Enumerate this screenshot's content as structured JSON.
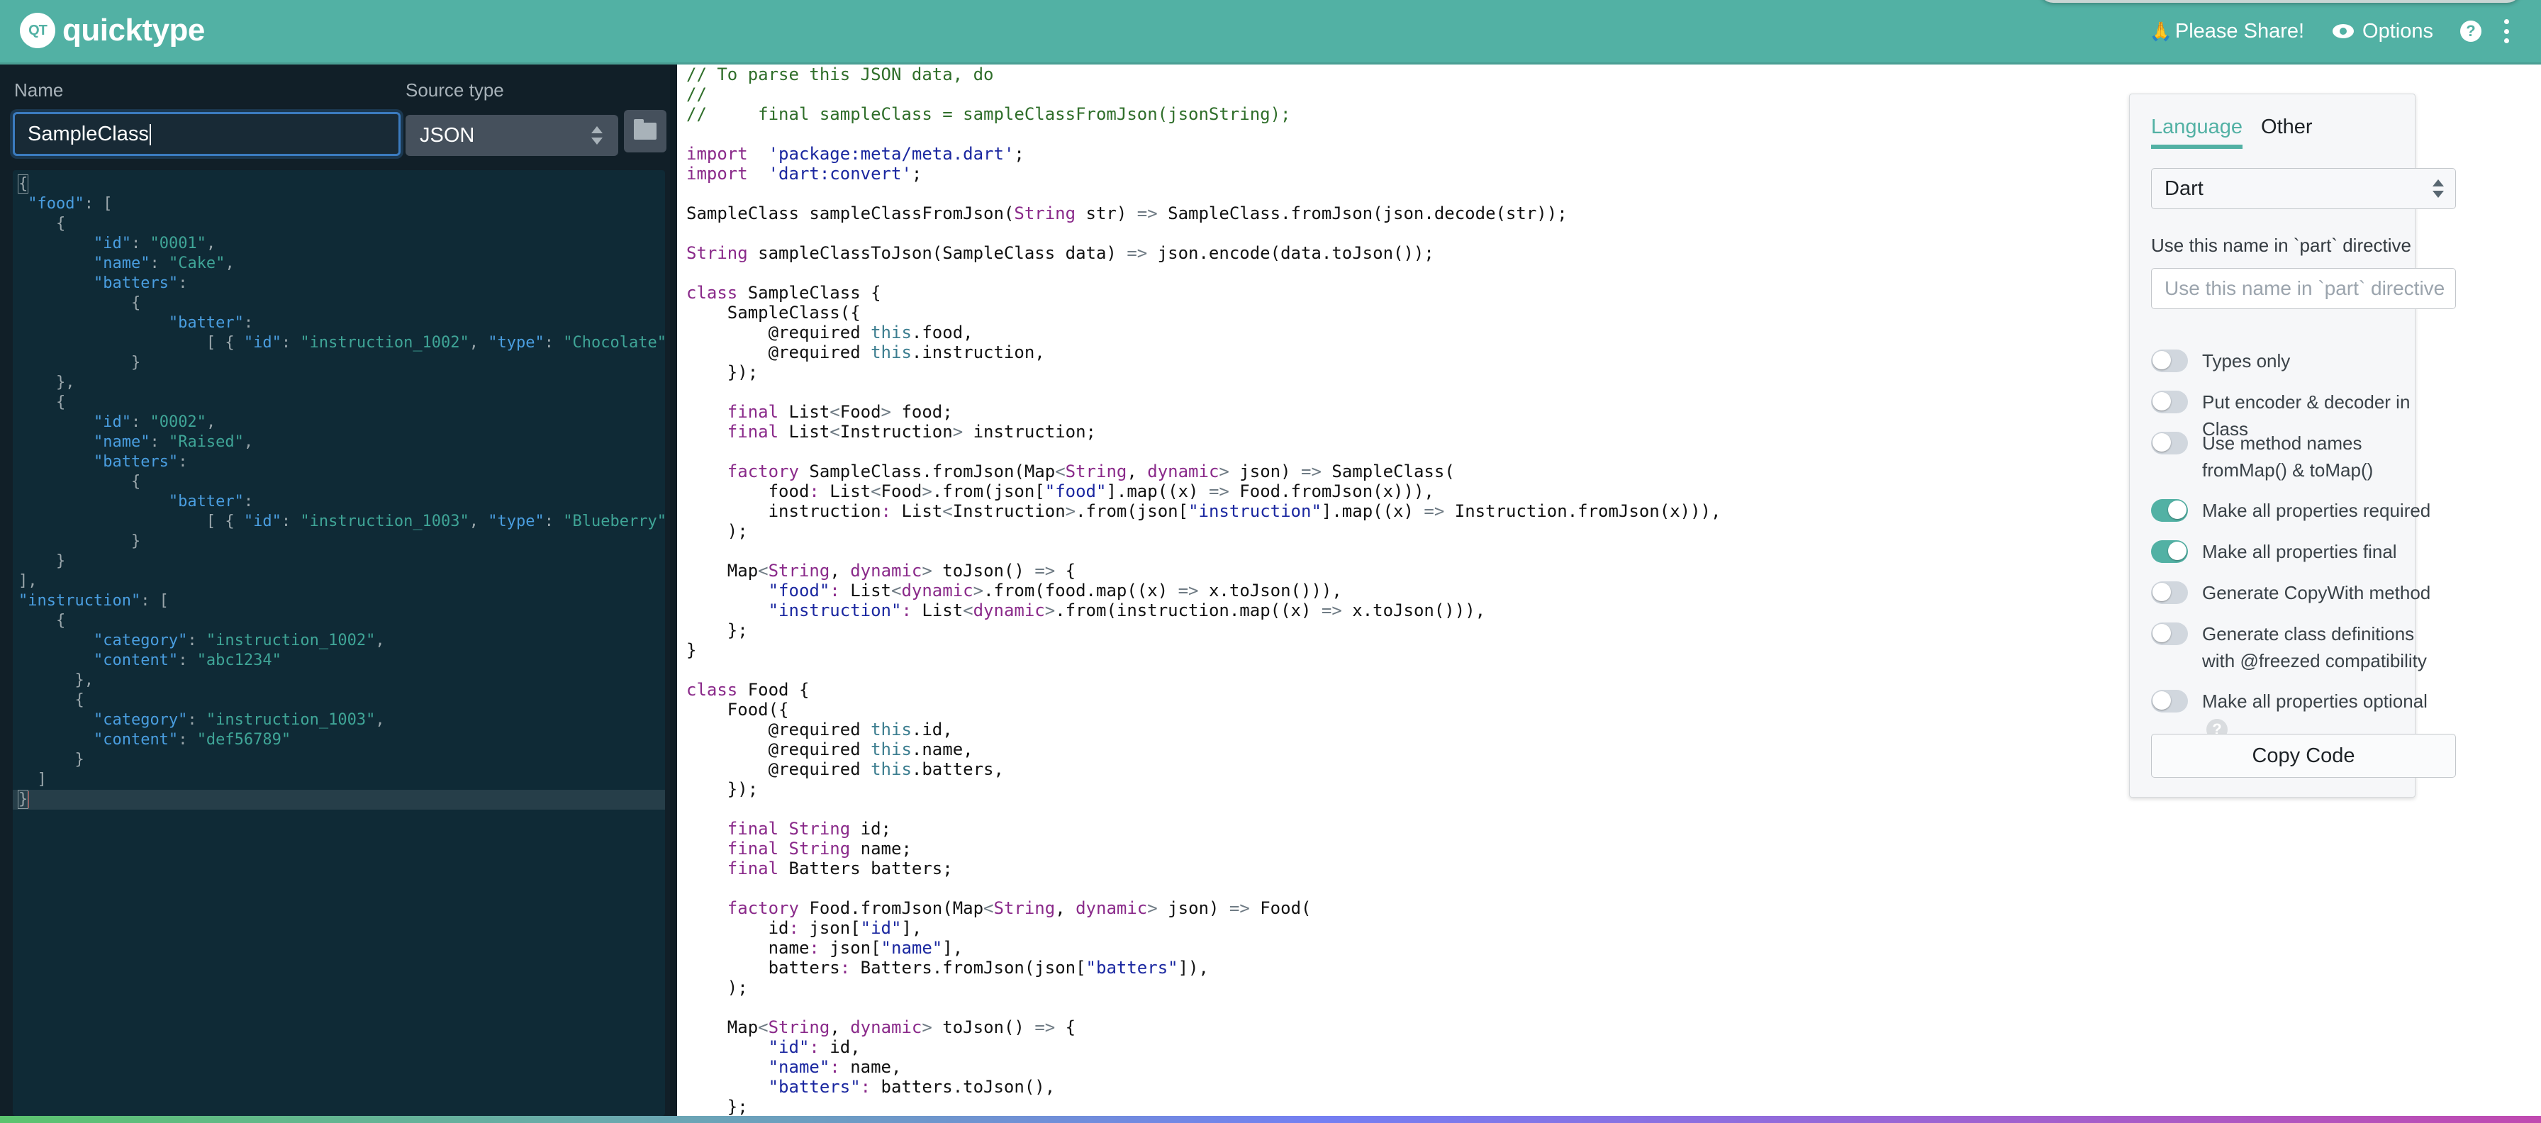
{
  "header": {
    "logo_badge": "QT",
    "logo_text": "quicktype",
    "share_emoji": "🙏",
    "share_label": "Please Share!",
    "options_label": "Options",
    "help_label": "?"
  },
  "source": {
    "name_label": "Name",
    "name_value": "SampleClass",
    "source_type_label": "Source type",
    "source_type_value": "JSON",
    "json_lines": [
      [
        [
          "jb",
          "{"
        ]
      ],
      [
        [
          "jb",
          " "
        ],
        [
          "jk",
          "\"food\""
        ],
        [
          "jb",
          ": ["
        ]
      ],
      [
        [
          "jb",
          "    {"
        ]
      ],
      [
        [
          "jb",
          "        "
        ],
        [
          "jk",
          "\"id\""
        ],
        [
          "jb",
          ": "
        ],
        [
          "js",
          "\"0001\""
        ],
        [
          "jb",
          ","
        ]
      ],
      [
        [
          "jb",
          "        "
        ],
        [
          "jk",
          "\"name\""
        ],
        [
          "jb",
          ": "
        ],
        [
          "js",
          "\"Cake\""
        ],
        [
          "jb",
          ","
        ]
      ],
      [
        [
          "jb",
          "        "
        ],
        [
          "jk",
          "\"batters\""
        ],
        [
          "jb",
          ":"
        ]
      ],
      [
        [
          "jb",
          "            {"
        ]
      ],
      [
        [
          "jb",
          "                "
        ],
        [
          "jk",
          "\"batter\""
        ],
        [
          "jb",
          ":"
        ]
      ],
      [
        [
          "jb",
          "                    [ { "
        ],
        [
          "jk",
          "\"id\""
        ],
        [
          "jb",
          ": "
        ],
        [
          "js",
          "\"instruction_1002\""
        ],
        [
          "jb",
          ", "
        ],
        [
          "jk",
          "\"type\""
        ],
        [
          "jb",
          ": "
        ],
        [
          "js",
          "\"Chocolate\""
        ],
        [
          "jb",
          " },"
        ]
      ],
      [
        [
          "jb",
          "            }"
        ]
      ],
      [
        [
          "jb",
          "    },"
        ]
      ],
      [
        [
          "jb",
          "    {"
        ]
      ],
      [
        [
          "jb",
          "        "
        ],
        [
          "jk",
          "\"id\""
        ],
        [
          "jb",
          ": "
        ],
        [
          "js",
          "\"0002\""
        ],
        [
          "jb",
          ","
        ]
      ],
      [
        [
          "jb",
          "        "
        ],
        [
          "jk",
          "\"name\""
        ],
        [
          "jb",
          ": "
        ],
        [
          "js",
          "\"Raised\""
        ],
        [
          "jb",
          ","
        ]
      ],
      [
        [
          "jb",
          "        "
        ],
        [
          "jk",
          "\"batters\""
        ],
        [
          "jb",
          ":"
        ]
      ],
      [
        [
          "jb",
          "            {"
        ]
      ],
      [
        [
          "jb",
          "                "
        ],
        [
          "jk",
          "\"batter\""
        ],
        [
          "jb",
          ":"
        ]
      ],
      [
        [
          "jb",
          "                    [ { "
        ],
        [
          "jk",
          "\"id\""
        ],
        [
          "jb",
          ": "
        ],
        [
          "js",
          "\"instruction_1003\""
        ],
        [
          "jb",
          ", "
        ],
        [
          "jk",
          "\"type\""
        ],
        [
          "jb",
          ": "
        ],
        [
          "js",
          "\"Blueberry\""
        ],
        [
          "jb",
          " },"
        ]
      ],
      [
        [
          "jb",
          "            }"
        ]
      ],
      [
        [
          "jb",
          "    }"
        ]
      ],
      [
        [
          "jb",
          "],"
        ]
      ],
      [
        [
          "jk",
          "\"instruction\""
        ],
        [
          "jb",
          ": ["
        ]
      ],
      [
        [
          "jb",
          "    {"
        ]
      ],
      [
        [
          "jb",
          "        "
        ],
        [
          "jk",
          "\"category\""
        ],
        [
          "jb",
          ": "
        ],
        [
          "js",
          "\"instruction_1002\""
        ],
        [
          "jb",
          ","
        ]
      ],
      [
        [
          "jb",
          "        "
        ],
        [
          "jk",
          "\"content\""
        ],
        [
          "jb",
          ": "
        ],
        [
          "js",
          "\"abc1234\""
        ]
      ],
      [
        [
          "jb",
          "      },"
        ]
      ],
      [
        [
          "jb",
          "      {"
        ]
      ],
      [
        [
          "jb",
          "        "
        ],
        [
          "jk",
          "\"category\""
        ],
        [
          "jb",
          ": "
        ],
        [
          "js",
          "\"instruction_1003\""
        ],
        [
          "jb",
          ","
        ]
      ],
      [
        [
          "jb",
          "        "
        ],
        [
          "jk",
          "\"content\""
        ],
        [
          "jb",
          ": "
        ],
        [
          "js",
          "\"def56789\""
        ]
      ],
      [
        [
          "jb",
          "      }"
        ]
      ],
      [
        [
          "jb",
          "  ]"
        ]
      ],
      [
        [
          "jb",
          "}"
        ]
      ]
    ]
  },
  "code_lines": [
    [
      [
        "c-com",
        "// To parse this JSON data, do"
      ]
    ],
    [
      [
        "c-com",
        "//"
      ]
    ],
    [
      [
        "c-com",
        "//     final sampleClass = sampleClassFromJson(jsonString);"
      ]
    ],
    [],
    [
      [
        "c-kw",
        "import"
      ],
      [
        "",
        "  "
      ],
      [
        "c-str",
        "'package:meta/meta.dart'"
      ],
      [
        "",
        ";"
      ]
    ],
    [
      [
        "c-kw",
        "import"
      ],
      [
        "",
        "  "
      ],
      [
        "c-str",
        "'dart:convert'"
      ],
      [
        "",
        ";"
      ]
    ],
    [],
    [
      [
        "",
        "SampleClass sampleClassFromJson("
      ],
      [
        "c-kw",
        "String"
      ],
      [
        "",
        " str) "
      ],
      [
        "c-op",
        "=>"
      ],
      [
        "",
        " SampleClass.fromJson(json.decode(str));"
      ]
    ],
    [],
    [
      [
        "c-kw",
        "String"
      ],
      [
        "",
        " sampleClassToJson(SampleClass data) "
      ],
      [
        "c-op",
        "=>"
      ],
      [
        "",
        " json.encode(data.toJson());"
      ]
    ],
    [],
    [
      [
        "c-kw",
        "class"
      ],
      [
        "",
        " SampleClass {"
      ]
    ],
    [
      [
        "",
        "    SampleClass({"
      ]
    ],
    [
      [
        "",
        "        @required "
      ],
      [
        "c-this",
        "this"
      ],
      [
        "",
        ".food,"
      ]
    ],
    [
      [
        "",
        "        @required "
      ],
      [
        "c-this",
        "this"
      ],
      [
        "",
        ".instruction,"
      ]
    ],
    [
      [
        "",
        "    });"
      ]
    ],
    [],
    [
      [
        "",
        "    "
      ],
      [
        "c-kw",
        "final"
      ],
      [
        "",
        " List"
      ],
      [
        "c-op",
        "<"
      ],
      [
        "",
        "Food"
      ],
      [
        "c-op",
        ">"
      ],
      [
        "",
        " food;"
      ]
    ],
    [
      [
        "",
        "    "
      ],
      [
        "c-kw",
        "final"
      ],
      [
        "",
        " List"
      ],
      [
        "c-op",
        "<"
      ],
      [
        "",
        "Instruction"
      ],
      [
        "c-op",
        ">"
      ],
      [
        "",
        " instruction;"
      ]
    ],
    [],
    [
      [
        "",
        "    "
      ],
      [
        "c-kw",
        "factory"
      ],
      [
        "",
        " SampleClass.fromJson(Map"
      ],
      [
        "c-op",
        "<"
      ],
      [
        "c-kw",
        "String"
      ],
      [
        "",
        ", "
      ],
      [
        "c-kw",
        "dynamic"
      ],
      [
        "c-op",
        ">"
      ],
      [
        "",
        " json) "
      ],
      [
        "c-op",
        "=>"
      ],
      [
        "",
        " SampleClass("
      ]
    ],
    [
      [
        "",
        "        food"
      ],
      [
        "c-kw",
        ":"
      ],
      [
        "",
        " List"
      ],
      [
        "c-op",
        "<"
      ],
      [
        "",
        "Food"
      ],
      [
        "c-op",
        ">"
      ],
      [
        "",
        ".from(json["
      ],
      [
        "c-str",
        "\"food\""
      ],
      [
        "",
        "].map((x) "
      ],
      [
        "c-op",
        "=>"
      ],
      [
        "",
        " Food.fromJson(x))),"
      ]
    ],
    [
      [
        "",
        "        instruction"
      ],
      [
        "c-kw",
        ":"
      ],
      [
        "",
        " List"
      ],
      [
        "c-op",
        "<"
      ],
      [
        "",
        "Instruction"
      ],
      [
        "c-op",
        ">"
      ],
      [
        "",
        ".from(json["
      ],
      [
        "c-str",
        "\"instruction\""
      ],
      [
        "",
        "].map((x) "
      ],
      [
        "c-op",
        "=>"
      ],
      [
        "",
        " Instruction.fromJson(x))),"
      ]
    ],
    [
      [
        "",
        "    );"
      ]
    ],
    [],
    [
      [
        "",
        "    Map"
      ],
      [
        "c-op",
        "<"
      ],
      [
        "c-kw",
        "String"
      ],
      [
        "",
        ", "
      ],
      [
        "c-kw",
        "dynamic"
      ],
      [
        "c-op",
        ">"
      ],
      [
        "",
        " toJson() "
      ],
      [
        "c-op",
        "=>"
      ],
      [
        "",
        " {"
      ]
    ],
    [
      [
        "",
        "        "
      ],
      [
        "c-str",
        "\"food\""
      ],
      [
        "c-kw",
        ":"
      ],
      [
        "",
        " List"
      ],
      [
        "c-op",
        "<"
      ],
      [
        "c-kw",
        "dynamic"
      ],
      [
        "c-op",
        ">"
      ],
      [
        "",
        ".from(food.map((x) "
      ],
      [
        "c-op",
        "=>"
      ],
      [
        "",
        " x.toJson())),"
      ]
    ],
    [
      [
        "",
        "        "
      ],
      [
        "c-str",
        "\"instruction\""
      ],
      [
        "c-kw",
        ":"
      ],
      [
        "",
        " List"
      ],
      [
        "c-op",
        "<"
      ],
      [
        "c-kw",
        "dynamic"
      ],
      [
        "c-op",
        ">"
      ],
      [
        "",
        ".from(instruction.map((x) "
      ],
      [
        "c-op",
        "=>"
      ],
      [
        "",
        " x.toJson())),"
      ]
    ],
    [
      [
        "",
        "    };"
      ]
    ],
    [
      [
        "",
        "}"
      ]
    ],
    [],
    [
      [
        "c-kw",
        "class"
      ],
      [
        "",
        " Food {"
      ]
    ],
    [
      [
        "",
        "    Food({"
      ]
    ],
    [
      [
        "",
        "        @required "
      ],
      [
        "c-this",
        "this"
      ],
      [
        "",
        ".id,"
      ]
    ],
    [
      [
        "",
        "        @required "
      ],
      [
        "c-this",
        "this"
      ],
      [
        "",
        ".name,"
      ]
    ],
    [
      [
        "",
        "        @required "
      ],
      [
        "c-this",
        "this"
      ],
      [
        "",
        ".batters,"
      ]
    ],
    [
      [
        "",
        "    });"
      ]
    ],
    [],
    [
      [
        "",
        "    "
      ],
      [
        "c-kw",
        "final"
      ],
      [
        "",
        " "
      ],
      [
        "c-kw",
        "String"
      ],
      [
        "",
        " id;"
      ]
    ],
    [
      [
        "",
        "    "
      ],
      [
        "c-kw",
        "final"
      ],
      [
        "",
        " "
      ],
      [
        "c-kw",
        "String"
      ],
      [
        "",
        " name;"
      ]
    ],
    [
      [
        "",
        "    "
      ],
      [
        "c-kw",
        "final"
      ],
      [
        "",
        " Batters batters;"
      ]
    ],
    [],
    [
      [
        "",
        "    "
      ],
      [
        "c-kw",
        "factory"
      ],
      [
        "",
        " Food.fromJson(Map"
      ],
      [
        "c-op",
        "<"
      ],
      [
        "c-kw",
        "String"
      ],
      [
        "",
        ", "
      ],
      [
        "c-kw",
        "dynamic"
      ],
      [
        "c-op",
        ">"
      ],
      [
        "",
        " json) "
      ],
      [
        "c-op",
        "=>"
      ],
      [
        "",
        " Food("
      ]
    ],
    [
      [
        "",
        "        id"
      ],
      [
        "c-kw",
        ":"
      ],
      [
        "",
        " json["
      ],
      [
        "c-str",
        "\"id\""
      ],
      [
        "",
        "],"
      ]
    ],
    [
      [
        "",
        "        name"
      ],
      [
        "c-kw",
        ":"
      ],
      [
        "",
        " json["
      ],
      [
        "c-str",
        "\"name\""
      ],
      [
        "",
        "],"
      ]
    ],
    [
      [
        "",
        "        batters"
      ],
      [
        "c-kw",
        ":"
      ],
      [
        "",
        " Batters.fromJson(json["
      ],
      [
        "c-str",
        "\"batters\""
      ],
      [
        "",
        "]),"
      ]
    ],
    [
      [
        "",
        "    );"
      ]
    ],
    [],
    [
      [
        "",
        "    Map"
      ],
      [
        "c-op",
        "<"
      ],
      [
        "c-kw",
        "String"
      ],
      [
        "",
        ", "
      ],
      [
        "c-kw",
        "dynamic"
      ],
      [
        "c-op",
        ">"
      ],
      [
        "",
        " toJson() "
      ],
      [
        "c-op",
        "=>"
      ],
      [
        "",
        " {"
      ]
    ],
    [
      [
        "",
        "        "
      ],
      [
        "c-str",
        "\"id\""
      ],
      [
        "c-kw",
        ":"
      ],
      [
        "",
        " id,"
      ]
    ],
    [
      [
        "",
        "        "
      ],
      [
        "c-str",
        "\"name\""
      ],
      [
        "c-kw",
        ":"
      ],
      [
        "",
        " name,"
      ]
    ],
    [
      [
        "",
        "        "
      ],
      [
        "c-str",
        "\"batters\""
      ],
      [
        "c-kw",
        ":"
      ],
      [
        "",
        " batters.toJson(),"
      ]
    ],
    [
      [
        "",
        "    };"
      ]
    ]
  ],
  "options_panel": {
    "tabs": [
      {
        "label": "Language",
        "active": true
      },
      {
        "label": "Other",
        "active": false
      }
    ],
    "language_value": "Dart",
    "part_label": "Use this name in `part` directive",
    "part_placeholder": "Use this name in `part` directive",
    "part_value": "",
    "toggles": [
      {
        "label": "Types only",
        "on": false
      },
      {
        "label": "Put encoder & decoder in Class",
        "on": false
      },
      {
        "label": "Use method names fromMap() & toMap()",
        "on": false
      },
      {
        "label": "Make all properties required",
        "on": true
      },
      {
        "label": "Make all properties final",
        "on": true
      },
      {
        "label": "Generate CopyWith method",
        "on": false
      },
      {
        "label": "Generate class definitions with @freezed compatibility",
        "on": false
      },
      {
        "label": "Make all properties optional",
        "on": false,
        "help": true
      }
    ],
    "help_glyph": "?",
    "copy_label": "Copy Code"
  },
  "colors": {
    "brand": "#52b1a4",
    "editor_bg": "#0f2a36",
    "sidebar_bg": "#111f28"
  }
}
